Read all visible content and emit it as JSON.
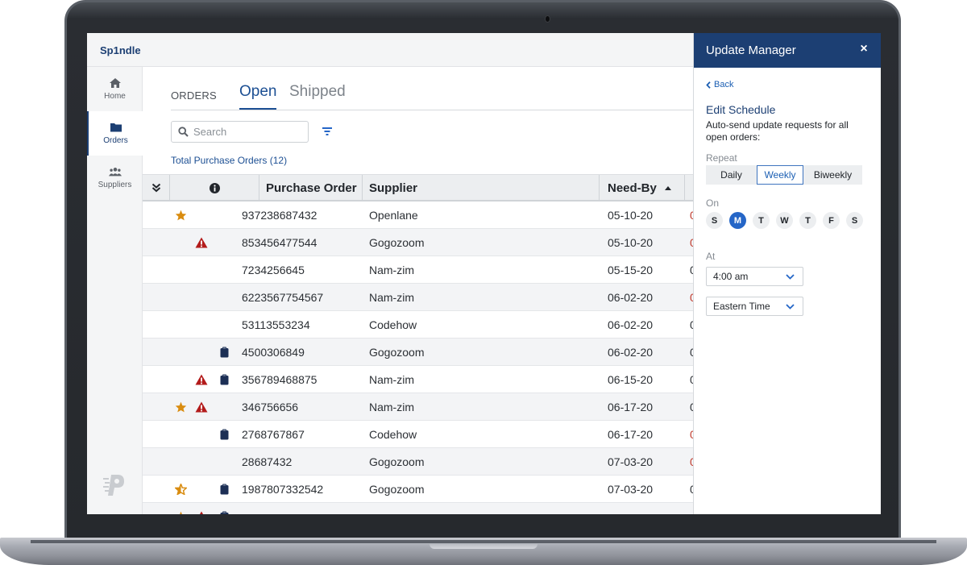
{
  "app": {
    "brand": "Sp1ndle"
  },
  "sidebar": {
    "items": [
      {
        "label": "Home",
        "icon": "home-icon",
        "active": false
      },
      {
        "label": "Orders",
        "icon": "folder-icon",
        "active": true
      },
      {
        "label": "Suppliers",
        "icon": "users-icon",
        "active": false
      }
    ]
  },
  "main": {
    "section_label": "ORDERS",
    "tabs": [
      {
        "label": "Open",
        "active": true
      },
      {
        "label": "Shipped",
        "active": false
      }
    ],
    "search": {
      "placeholder": "Search",
      "value": ""
    },
    "total_label": "Total Purchase Orders (12)",
    "table": {
      "columns": [
        "",
        "",
        "Purchase Order",
        "Supplier",
        "Need-By",
        ""
      ],
      "sort": {
        "column": "Need-By",
        "direction": "asc"
      },
      "rows": [
        {
          "starred": "full",
          "alert": false,
          "note": false,
          "po": "937238687432",
          "supplier": "Openlane",
          "need_by": "05-10-20",
          "next_late": true
        },
        {
          "starred": "none",
          "alert": true,
          "note": false,
          "po": "853456477544",
          "supplier": "Gogozoom",
          "need_by": "05-10-20",
          "next_late": true
        },
        {
          "starred": "none",
          "alert": false,
          "note": false,
          "po": "7234256645",
          "supplier": "Nam-zim",
          "need_by": "05-15-20",
          "next_late": false
        },
        {
          "starred": "none",
          "alert": false,
          "note": false,
          "po": "6223567754567",
          "supplier": "Nam-zim",
          "need_by": "06-02-20",
          "next_late": true
        },
        {
          "starred": "none",
          "alert": false,
          "note": false,
          "po": "53113553234",
          "supplier": "Codehow",
          "need_by": "06-02-20",
          "next_late": false
        },
        {
          "starred": "none",
          "alert": false,
          "note": true,
          "po": "4500306849",
          "supplier": "Gogozoom",
          "need_by": "06-02-20",
          "next_late": false
        },
        {
          "starred": "none",
          "alert": true,
          "note": true,
          "po": "356789468875",
          "supplier": "Nam-zim",
          "need_by": "06-15-20",
          "next_late": false
        },
        {
          "starred": "full",
          "alert": true,
          "note": false,
          "po": "346756656",
          "supplier": "Nam-zim",
          "need_by": "06-17-20",
          "next_late": false
        },
        {
          "starred": "none",
          "alert": false,
          "note": true,
          "po": "2768767867",
          "supplier": "Codehow",
          "need_by": "06-17-20",
          "next_late": true
        },
        {
          "starred": "none",
          "alert": false,
          "note": false,
          "po": "28687432",
          "supplier": "Gogozoom",
          "need_by": "07-03-20",
          "next_late": true
        },
        {
          "starred": "half",
          "alert": false,
          "note": true,
          "po": "1987807332542",
          "supplier": "Gogozoom",
          "need_by": "07-03-20",
          "next_late": false
        },
        {
          "starred": "full",
          "alert": true,
          "note": true,
          "po": "",
          "supplier": "",
          "need_by": "",
          "next_late": false
        }
      ]
    }
  },
  "panel": {
    "title": "Update Manager",
    "close_label": "×",
    "back_label": "Back",
    "edit_title": "Edit Schedule",
    "description": "Auto-send update requests for all open orders:",
    "repeat_label": "Repeat",
    "repeat_options": [
      "Daily",
      "Weekly",
      "Biweekly"
    ],
    "repeat_selected": "Weekly",
    "on_label": "On",
    "days": [
      "S",
      "M",
      "T",
      "W",
      "T",
      "F",
      "S"
    ],
    "day_selected_index": 1,
    "at_label": "At",
    "time_value": "4:00 am",
    "timezone_value": "Eastern Time"
  },
  "colors": {
    "brand": "#1c3f73",
    "accent": "#2566c7",
    "star": "#d98c10",
    "alert": "#b31b1b",
    "note": "#1c2f55",
    "late": "#c0392b"
  }
}
